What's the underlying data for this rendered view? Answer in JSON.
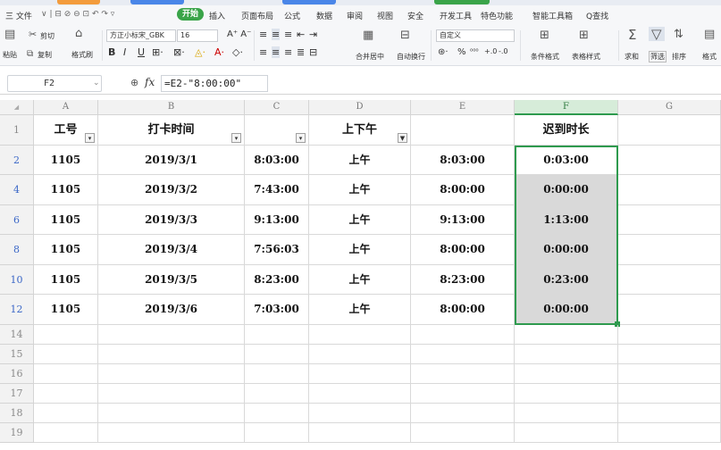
{
  "menu": {
    "items": [
      "三 文件",
      "开始",
      "插入",
      "页面布局",
      "公式",
      "数据",
      "审阅",
      "视图",
      "安全",
      "开发工具",
      "特色功能",
      "智能工具箱",
      "Q查找"
    ]
  },
  "toolbar": {
    "paste": "粘贴",
    "cut": "剪切",
    "copy": "复制",
    "format_painter": "格式刷",
    "font_name": "方正小标宋_GBK",
    "font_size": "16",
    "merge_center": "合并居中",
    "auto_wrap": "自动换行",
    "number_format": "自定义",
    "percent": "%",
    "cond_format": "条件格式",
    "table_style": "表格样式",
    "sum": "求和",
    "filter": "筛选",
    "sort": "排序",
    "format": "格式"
  },
  "formula_bar": {
    "cell_ref": "F2",
    "fx": "fx",
    "formula": "=E2-\"8:00:00\""
  },
  "sheet": {
    "columns": [
      "A",
      "B",
      "C",
      "D",
      "E",
      "F",
      "G"
    ],
    "header_row_num": "1",
    "headers": [
      "工号",
      "打卡时间",
      "",
      "上下午",
      "",
      "迟到时长"
    ],
    "rows": [
      {
        "num": "2",
        "cells": [
          "1105",
          "2019/3/1",
          "8:03:00",
          "上午",
          "8:03:00",
          "0:03:00"
        ]
      },
      {
        "num": "4",
        "cells": [
          "1105",
          "2019/3/2",
          "7:43:00",
          "上午",
          "8:00:00",
          "0:00:00"
        ]
      },
      {
        "num": "6",
        "cells": [
          "1105",
          "2019/3/3",
          "9:13:00",
          "上午",
          "9:13:00",
          "1:13:00"
        ]
      },
      {
        "num": "8",
        "cells": [
          "1105",
          "2019/3/4",
          "7:56:03",
          "上午",
          "8:00:00",
          "0:00:00"
        ]
      },
      {
        "num": "10",
        "cells": [
          "1105",
          "2019/3/5",
          "8:23:00",
          "上午",
          "8:23:00",
          "0:23:00"
        ]
      },
      {
        "num": "12",
        "cells": [
          "1105",
          "2019/3/6",
          "7:03:00",
          "上午",
          "8:00:00",
          "0:00:00"
        ]
      }
    ],
    "empty_rows": [
      "14",
      "15",
      "16",
      "17",
      "18",
      "19"
    ]
  },
  "colors": {
    "accent_green": "#3aa449",
    "selection_green": "#2e9a4e",
    "filtered_row_num": "#3b67c7"
  }
}
